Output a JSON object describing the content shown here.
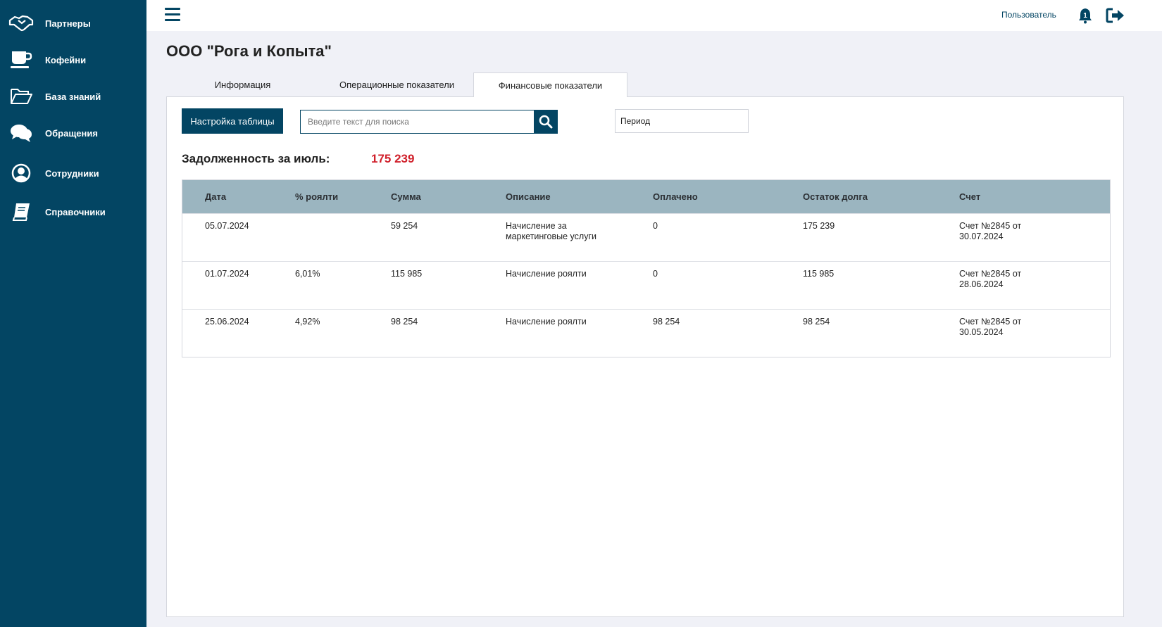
{
  "sidebar": {
    "items": [
      {
        "label": "Партнеры",
        "icon": "handshake-icon"
      },
      {
        "label": "Кофейни",
        "icon": "coffee-cup-icon"
      },
      {
        "label": "База знаний",
        "icon": "folder-open-icon"
      },
      {
        "label": "Обращения",
        "icon": "chat-bubbles-icon"
      },
      {
        "label": "Сотрудники",
        "icon": "user-circle-icon"
      },
      {
        "label": "Справочники",
        "icon": "book-icon"
      }
    ]
  },
  "header": {
    "user_label": "Пользователь",
    "notification_count": "1"
  },
  "page": {
    "title": "ООО \"Рога и Копыта\""
  },
  "tabs": [
    {
      "label": "Информация",
      "active": false
    },
    {
      "label": "Операционные показатели",
      "active": false
    },
    {
      "label": "Финансовые показатели",
      "active": true
    }
  ],
  "toolbar": {
    "settings_label": "Настройка таблицы",
    "search_placeholder": "Введите текст для поиска",
    "period_placeholder": "Период"
  },
  "summary": {
    "label": "Задолженность за июль:",
    "value": "175 239"
  },
  "table": {
    "columns": [
      "Дата",
      "% роялти",
      "Сумма",
      "Описание",
      "Оплачено",
      "Остаток долга",
      "Счет"
    ],
    "rows": [
      {
        "date": "05.07.2024",
        "royalty": "",
        "sum": "59 254",
        "description": "Начисление за маркетинговые услуги",
        "paid": "0",
        "remaining": "175 239",
        "invoice": "Счет №2845 от 30.07.2024"
      },
      {
        "date": "01.07.2024",
        "royalty": "6,01%",
        "sum": "115 985",
        "description": "Начисление роялти",
        "paid": "0",
        "remaining": "115 985",
        "invoice": "Счет №2845 от 28.06.2024"
      },
      {
        "date": "25.06.2024",
        "royalty": "4,92%",
        "sum": "98 254",
        "description": "Начисление роялти",
        "paid": "98 254",
        "remaining": "98 254",
        "invoice": "Счет №2845 от 30.05.2024"
      }
    ]
  },
  "colors": {
    "sidebar_bg": "#034563",
    "accent": "#034563",
    "table_header_bg": "#9bb5c0",
    "debt_value": "#d01f2a"
  }
}
